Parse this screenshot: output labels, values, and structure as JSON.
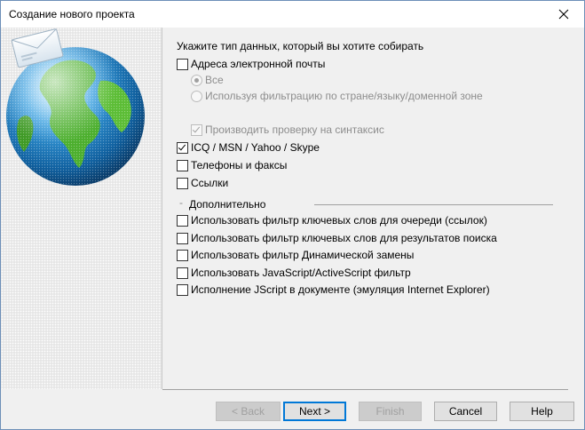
{
  "window": {
    "title": "Создание нового проекта"
  },
  "heading": "Укажите тип данных, который вы хотите собирать",
  "options": {
    "emails": {
      "label": "Адреса электронной почты",
      "checked": false
    },
    "all": {
      "label": "Все",
      "selected": true,
      "disabled": true
    },
    "filtered": {
      "label": "Используя фильтрацию по стране/языку/доменной зоне",
      "selected": false,
      "disabled": true
    },
    "syntax": {
      "label": "Производить проверку на синтаксис",
      "checked": true,
      "disabled": true
    },
    "icq": {
      "label": "ICQ / MSN / Yahoo / Skype",
      "checked": true
    },
    "phones": {
      "label": "Телефоны и факсы",
      "checked": false
    },
    "links": {
      "label": "Ссылки",
      "checked": false
    }
  },
  "advanced": {
    "group_label": "Дополнительно",
    "items": [
      {
        "label": "Использовать фильтр ключевых слов для очереди (ссылок)",
        "checked": false
      },
      {
        "label": "Использовать фильтр ключевых слов для результатов поиска",
        "checked": false
      },
      {
        "label": "Использовать фильтр Динамической замены",
        "checked": false
      },
      {
        "label": "Использовать JavaScript/ActiveScript фильтр",
        "checked": false
      },
      {
        "label": "Исполнение JScript в документе (эмуляция Internet Explorer)",
        "checked": false
      }
    ]
  },
  "buttons": {
    "back": "< Back",
    "next": "Next >",
    "finish": "Finish",
    "cancel": "Cancel",
    "help": "Help"
  },
  "colors": {
    "accent": "#0078d7",
    "ocean": "#1f7fc4",
    "land": "#4caf2e"
  },
  "icons": {
    "close": "close-icon",
    "globe": "globe-mail-icon"
  }
}
